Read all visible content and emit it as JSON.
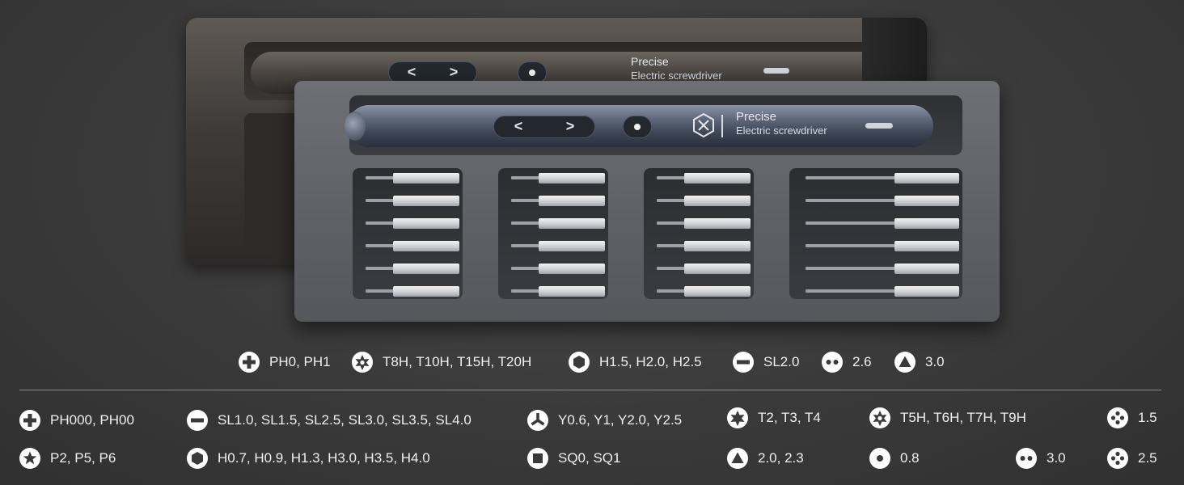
{
  "product": {
    "brand_title": "Precise",
    "brand_subtitle": "Electric screwdriver",
    "prev_glyph": "<",
    "next_glyph": ">"
  },
  "bits_per_column": 6,
  "legend_top": [
    {
      "icon": "phillips-icon",
      "text": "PH0, PH1"
    },
    {
      "icon": "torx-security-icon",
      "text": "T8H, T10H, T15H, T20H"
    },
    {
      "icon": "hex-icon",
      "text": "H1.5, H2.0, H2.5"
    },
    {
      "icon": "slotted-icon",
      "text": "SL2.0"
    },
    {
      "icon": "spanner-icon",
      "text": "2.6"
    },
    {
      "icon": "triangle-icon",
      "text": "3.0"
    }
  ],
  "legend_bottom": [
    {
      "icon": "phillips-icon",
      "text": "PH000, PH00"
    },
    {
      "icon": "slotted-icon",
      "text": "SL1.0, SL1.5, SL2.5, SL3.0, SL3.5, SL4.0"
    },
    {
      "icon": "tri-wing-icon",
      "text": "Y0.6, Y1, Y2.0, Y2.5"
    },
    {
      "icon": "torx-icon",
      "text": "T2, T3, T4"
    },
    {
      "icon": "torx-security-icon",
      "text": "T5H, T6H, T7H, T9H"
    },
    {
      "icon": "cross-dot-icon",
      "text": "1.5"
    },
    {
      "icon": "pentalobe-icon",
      "text": "P2, P5, P6"
    },
    {
      "icon": "hex-icon",
      "text": "H0.7, H0.9, H1.3, H3.0, H3.5, H4.0"
    },
    {
      "icon": "square-icon",
      "text": "SQ0, SQ1"
    },
    {
      "icon": "triangle-icon",
      "text": "2.0, 2.3"
    },
    {
      "icon": "round-dot-icon",
      "text": "0.8"
    },
    {
      "icon": "spanner-icon",
      "text": "3.0"
    },
    {
      "icon": "cross-dot-icon",
      "text": "2.5"
    }
  ]
}
